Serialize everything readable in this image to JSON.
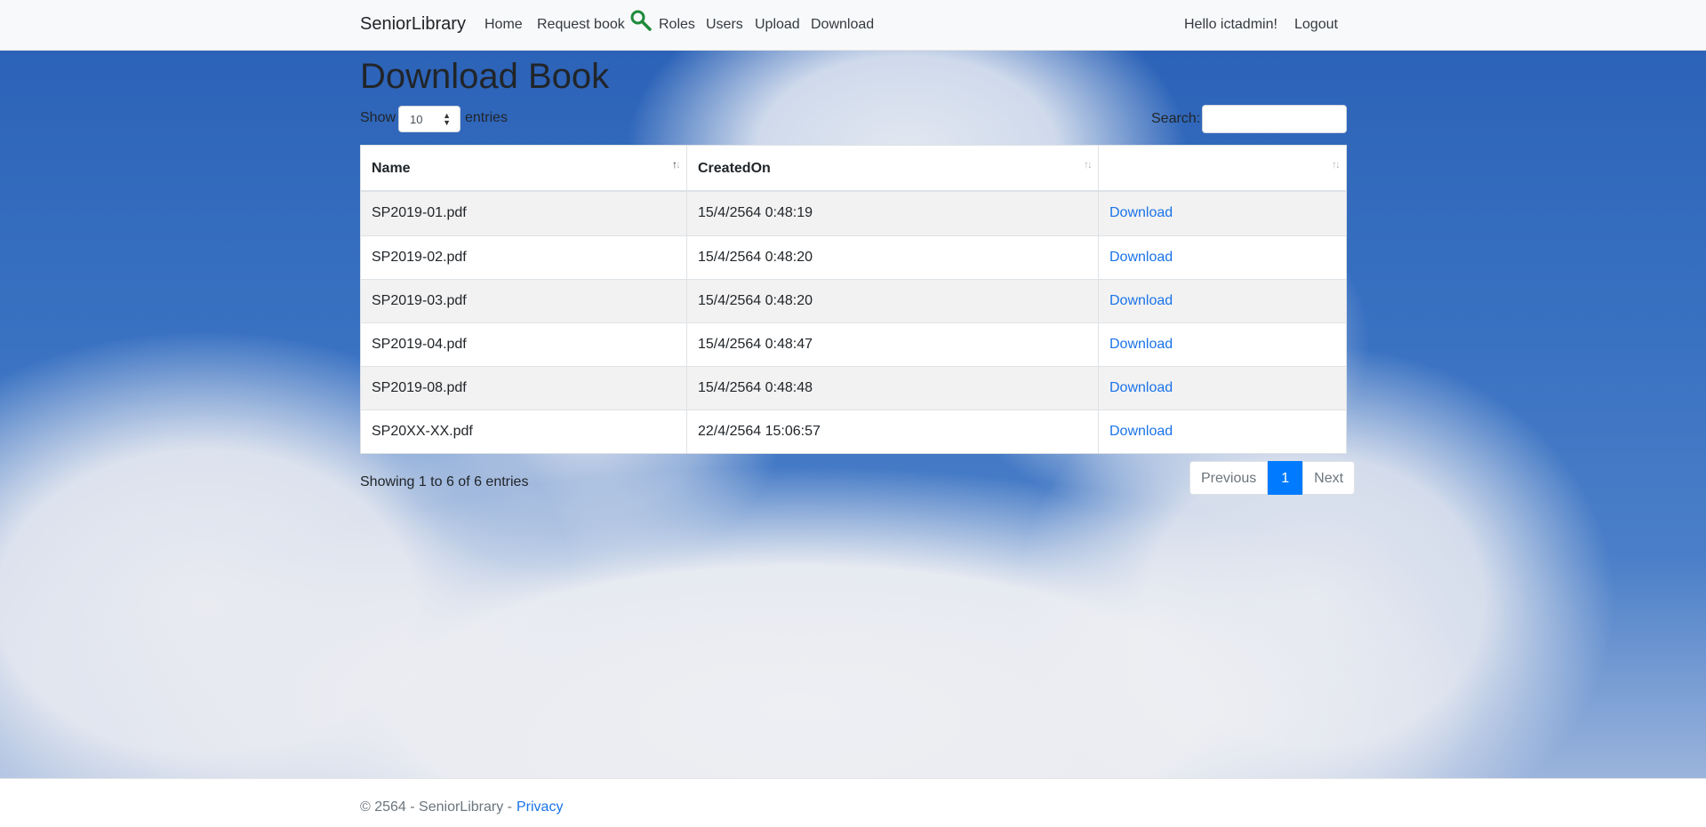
{
  "nav": {
    "brand": "SeniorLibrary",
    "links": [
      "Home",
      "Request book",
      "Roles",
      "Users",
      "Upload",
      "Download"
    ],
    "greeting": "Hello ictadmin!",
    "logout": "Logout"
  },
  "page": {
    "title": "Download Book",
    "show_label": "Show",
    "entries_value": "10",
    "entries_label": "entries",
    "search_label": "Search:",
    "search_value": ""
  },
  "table": {
    "headers": [
      "Name",
      "CreatedOn",
      ""
    ],
    "rows": [
      {
        "name": "SP2019-01.pdf",
        "created": "15/4/2564 0:48:19",
        "action": "Download"
      },
      {
        "name": "SP2019-02.pdf",
        "created": "15/4/2564 0:48:20",
        "action": "Download"
      },
      {
        "name": "SP2019-03.pdf",
        "created": "15/4/2564 0:48:20",
        "action": "Download"
      },
      {
        "name": "SP2019-04.pdf",
        "created": "15/4/2564 0:48:47",
        "action": "Download"
      },
      {
        "name": "SP2019-08.pdf",
        "created": "15/4/2564 0:48:48",
        "action": "Download"
      },
      {
        "name": "SP20XX-XX.pdf",
        "created": "22/4/2564 15:06:57",
        "action": "Download"
      }
    ]
  },
  "pagination": {
    "info": "Showing 1 to 6 of 6 entries",
    "previous": "Previous",
    "current": "1",
    "next": "Next"
  },
  "footer": {
    "text": "© 2564 - SeniorLibrary -",
    "privacy": "Privacy"
  },
  "colors": {
    "link": "#1a73e8",
    "active_page": "#007bff",
    "search_icon": "#1e8a3c"
  },
  "icons": {
    "search": "search-icon",
    "sort": "sort-icon"
  }
}
